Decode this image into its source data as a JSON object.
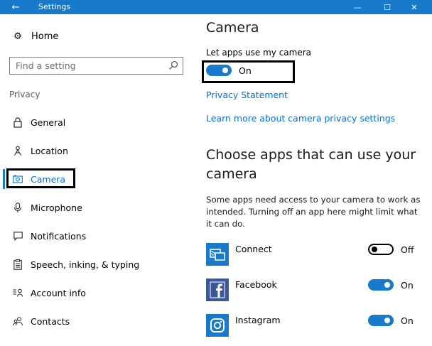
{
  "window": {
    "title": "Settings",
    "back_icon": "back-arrow-icon",
    "controls": {
      "minimize": "—",
      "maximize": "☐",
      "close": "✕"
    }
  },
  "sidebar": {
    "home_label": "Home",
    "search_placeholder": "Find a setting",
    "section_label": "Privacy",
    "items": [
      {
        "label": "General",
        "icon": "lock-icon",
        "active": false
      },
      {
        "label": "Location",
        "icon": "location-person-icon",
        "active": false
      },
      {
        "label": "Camera",
        "icon": "camera-icon",
        "active": true
      },
      {
        "label": "Microphone",
        "icon": "microphone-icon",
        "active": false
      },
      {
        "label": "Notifications",
        "icon": "notification-icon",
        "active": false
      },
      {
        "label": "Speech, inking, & typing",
        "icon": "clipboard-icon",
        "active": false
      },
      {
        "label": "Account info",
        "icon": "account-info-icon",
        "active": false
      },
      {
        "label": "Contacts",
        "icon": "contacts-icon",
        "active": false
      }
    ]
  },
  "main": {
    "title": "Camera",
    "master_toggle_label": "Let apps use my camera",
    "master_toggle_state": "On",
    "privacy_statement_link": "Privacy Statement",
    "learn_more_link": "Learn more about camera privacy settings",
    "apps_heading": "Choose apps that can use your camera",
    "apps_description": "Some apps need access to your camera to work as intended. Turning off an app here might limit what it can do.",
    "apps": [
      {
        "name": "Connect",
        "state": "Off",
        "on": false,
        "icon": "connect-app-icon"
      },
      {
        "name": "Facebook",
        "state": "On",
        "on": true,
        "icon": "facebook-app-icon"
      },
      {
        "name": "Instagram",
        "state": "On",
        "on": true,
        "icon": "instagram-app-icon"
      }
    ]
  },
  "colors": {
    "accent": "#1979ca",
    "link": "#0a6dcf",
    "highlight_border": "#000000"
  }
}
